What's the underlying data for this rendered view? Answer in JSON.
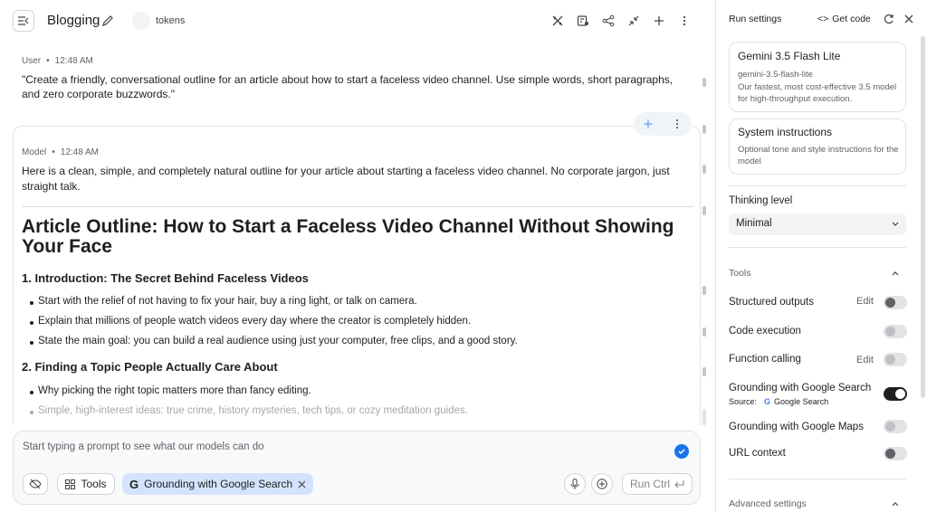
{
  "header": {
    "title": "Blogging",
    "tokens_label": "tokens"
  },
  "user_turn": {
    "role": "User",
    "time": "12:48 AM",
    "text": "\"Create a friendly, conversational outline for an article about how to start a faceless video channel. Use simple words, short paragraphs, and zero corporate buzzwords.\""
  },
  "model_turn": {
    "role": "Model",
    "time": "12:48 AM",
    "intro": "Here is a clean, simple, and completely natural outline for your article about starting a faceless video channel. No corporate jargon, just straight talk.",
    "heading": "Article Outline: How to Start a Faceless Video Channel Without Showing Your Face",
    "sections": [
      {
        "title": "1. Introduction: The Secret Behind Faceless Videos",
        "bullets": [
          "Start with the relief of not having to fix your hair, buy a ring light, or talk on camera.",
          "Explain that millions of people watch videos every day where the creator is completely hidden.",
          "State the main goal: you can build a real audience using just your computer, free clips, and a good story."
        ]
      },
      {
        "title": "2. Finding a Topic People Actually Care About",
        "bullets": [
          "Why picking the right topic matters more than fancy editing.",
          "Simple, high-interest ideas: true crime, history mysteries, tech tips, or cozy meditation guides."
        ]
      }
    ]
  },
  "composer": {
    "placeholder": "Start typing a prompt to see what our models can do",
    "tools_label": "Tools",
    "grounding_chip": "Grounding with Google Search",
    "run_label": "Run Ctrl"
  },
  "settings": {
    "title": "Run settings",
    "get_code": "Get code",
    "model": {
      "name": "Gemini 3.5 Flash Lite",
      "id": "gemini-3.5-flash-lite",
      "description": "Our fastest, most cost-effective 3.5 model for high-throughput execution."
    },
    "system_instructions": {
      "title": "System instructions",
      "description": "Optional tone and style instructions for the model"
    },
    "thinking_level_label": "Thinking level",
    "thinking_level_value": "Minimal",
    "tools_label": "Tools",
    "tools": [
      {
        "label": "Structured outputs",
        "edit": "Edit",
        "on": false
      },
      {
        "label": "Code execution",
        "edit": "",
        "on": false
      },
      {
        "label": "Function calling",
        "edit": "Edit",
        "on": false
      },
      {
        "label": "Grounding with Google Search",
        "edit": "",
        "on": true
      },
      {
        "label": "Grounding with Google Maps",
        "edit": "",
        "on": false
      },
      {
        "label": "URL context",
        "edit": "",
        "on": false
      }
    ],
    "source_label": "Source:",
    "source_value": "Google Search",
    "advanced_label": "Advanced settings"
  },
  "colors": {
    "accent": "#1a73e8",
    "chip_bg": "#d3e3fd",
    "toggle_on": "#1f1f1f"
  }
}
